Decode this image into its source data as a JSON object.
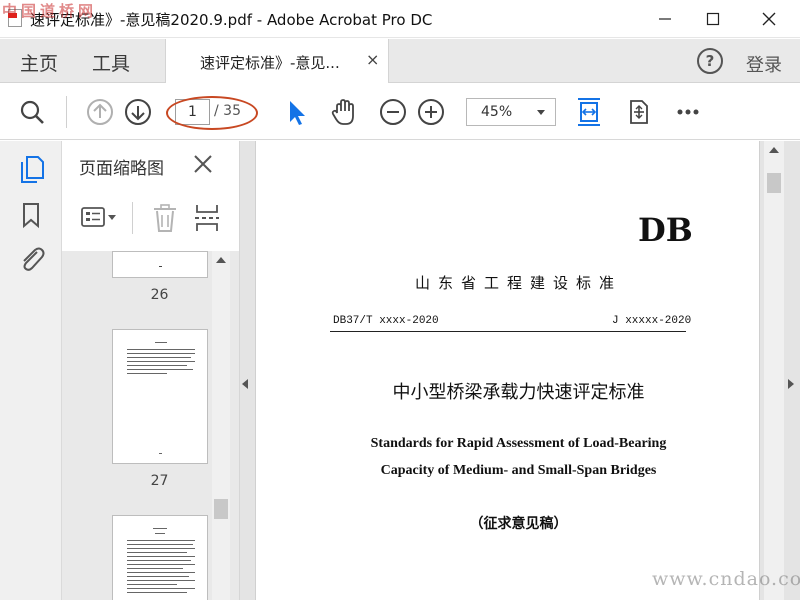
{
  "window": {
    "title": "速评定标准》-意见稿2020.9.pdf - Adobe Acrobat Pro DC",
    "watermark_tl": "中国道桥网"
  },
  "tabs": {
    "home": "主页",
    "tools": "工具",
    "doc_tab_label": "速评定标准》-意见...",
    "doc_tab_close": "×",
    "help": "?",
    "login": "登录"
  },
  "toolbar": {
    "current_page": "1",
    "total_pages": "/ 35",
    "zoom": "45%",
    "annotation_color": "#c84822",
    "accent_color": "#1473e6"
  },
  "thumb_pane": {
    "title": "页面缩略图",
    "pages": [
      {
        "number": "26"
      },
      {
        "number": "27"
      }
    ]
  },
  "document": {
    "header_code": "DB",
    "standard_type": "山东省工程建设标准",
    "code_left": "DB37/T xxxx-2020",
    "code_right": "J xxxxx-2020",
    "title_cn": "中小型桥梁承载力快速评定标准",
    "title_en_line1": "Standards for Rapid Assessment of Load-Bearing",
    "title_en_line2": "Capacity of Medium- and Small-Span Bridges",
    "draft_note": "（征求意见稿）"
  },
  "watermark_br": "www.cndao.com",
  "icons": [
    "pdf-file-icon",
    "minimize-icon",
    "maximize-icon",
    "close-icon",
    "search-icon",
    "previous-page-icon",
    "next-page-icon",
    "select-pointer-icon",
    "hand-tool-icon",
    "zoom-out-icon",
    "zoom-in-icon",
    "fit-page-icon",
    "rotate-icon",
    "more-icon",
    "page-thumbnails-icon",
    "bookmark-icon",
    "attachment-icon",
    "thumbnail-options-icon",
    "trash-icon",
    "insert-page-icon"
  ]
}
